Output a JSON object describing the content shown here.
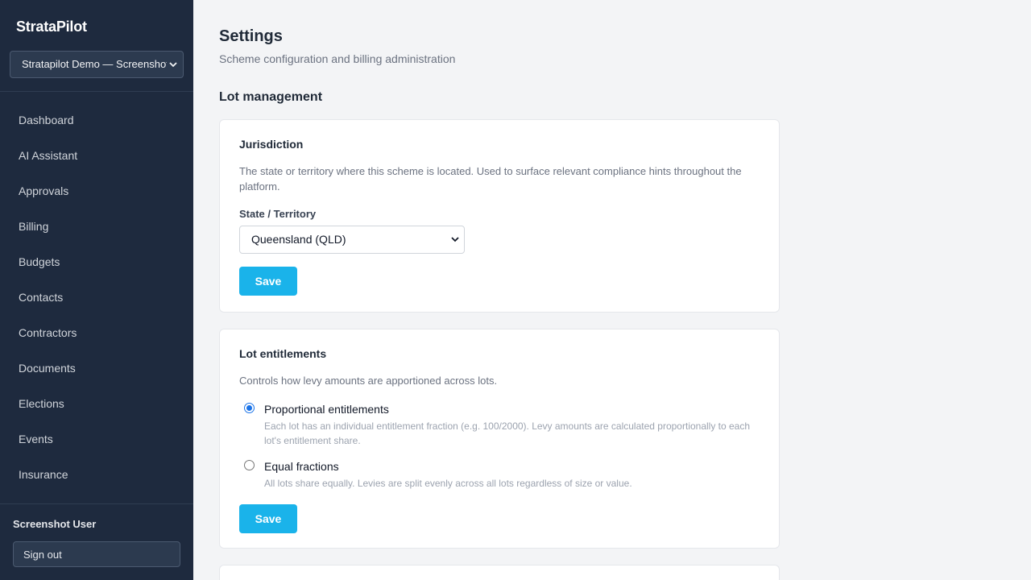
{
  "sidebar": {
    "brand": "StrataPilot",
    "scheme_selected": "Stratapilot Demo — Screenshot",
    "items": [
      {
        "label": "Dashboard"
      },
      {
        "label": "AI Assistant"
      },
      {
        "label": "Approvals"
      },
      {
        "label": "Billing"
      },
      {
        "label": "Budgets"
      },
      {
        "label": "Contacts"
      },
      {
        "label": "Contractors"
      },
      {
        "label": "Documents"
      },
      {
        "label": "Elections"
      },
      {
        "label": "Events"
      },
      {
        "label": "Insurance"
      }
    ],
    "user_name": "Screenshot User",
    "signout_label": "Sign out"
  },
  "header": {
    "title": "Settings",
    "subtitle": "Scheme configuration and billing administration"
  },
  "section": {
    "title": "Lot management"
  },
  "jurisdiction": {
    "title": "Jurisdiction",
    "description": "The state or territory where this scheme is located. Used to surface relevant compliance hints throughout the platform.",
    "field_label": "State / Territory",
    "selected": "Queensland (QLD)",
    "save_label": "Save"
  },
  "entitlements": {
    "title": "Lot entitlements",
    "description": "Controls how levy amounts are apportioned across lots.",
    "options": [
      {
        "label": "Proportional entitlements",
        "help": "Each lot has an individual entitlement fraction (e.g. 100/2000). Levy amounts are calculated proportionally to each lot's entitlement share.",
        "checked": true
      },
      {
        "label": "Equal fractions",
        "help": "All lots share equally. Levies are split evenly across all lots regardless of size or value.",
        "checked": false
      }
    ],
    "save_label": "Save"
  },
  "colors": {
    "sidebar_bg": "#1e2a3e",
    "accent": "#1ab3ea",
    "page_bg": "#f3f4f6"
  }
}
